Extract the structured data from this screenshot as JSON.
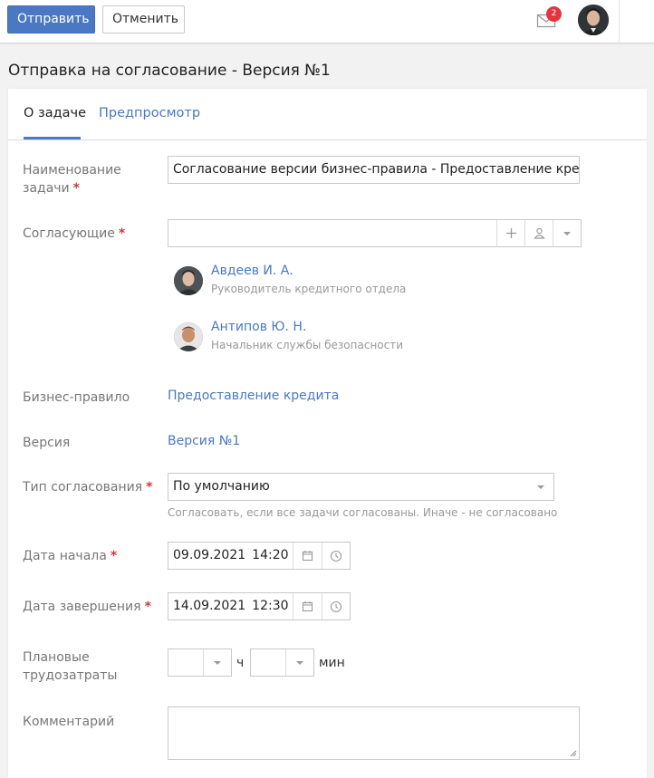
{
  "toolbar": {
    "send_label": "Отправить",
    "cancel_label": "Отменить"
  },
  "header": {
    "notifications_count": "2"
  },
  "page": {
    "title": "Отправка на согласование - Версия №1"
  },
  "tabs": [
    {
      "label": "О задаче",
      "active": true
    },
    {
      "label": "Предпросмотр",
      "active": false
    }
  ],
  "form": {
    "task_name": {
      "label_line1": "Наименование",
      "label_line2": "задачи",
      "value": "Согласование версии бизнес-правила - Предоставление кре"
    },
    "approvers": {
      "label": "Согласующие",
      "value": "",
      "people": [
        {
          "name": "Авдеев И. А.",
          "role": "Руководитель кредитного отдела"
        },
        {
          "name": "Антипов Ю. Н.",
          "role": "Начальник службы безопасности"
        }
      ]
    },
    "business_rule": {
      "label": "Бизнес-правило",
      "value": "Предоставление кредита"
    },
    "version": {
      "label": "Версия",
      "value": "Версия №1"
    },
    "approval_type": {
      "label": "Тип согласования",
      "value": "По умолчанию",
      "hint": "Согласовать, если все задачи согласованы. Иначе - не согласовано"
    },
    "start_date": {
      "label": "Дата начала",
      "date": "09.09.2021",
      "time": "14:20"
    },
    "end_date": {
      "label": "Дата завершения",
      "date": "14.09.2021",
      "time": "12:30"
    },
    "effort": {
      "label_line1": "Плановые",
      "label_line2": "трудозатраты",
      "hours_value": "",
      "hours_unit": "ч",
      "minutes_value": "",
      "minutes_unit": "мин"
    },
    "comment": {
      "label": "Комментарий",
      "value": ""
    }
  },
  "colors": {
    "accent": "#4a78c2",
    "required": "#d0383f",
    "badge": "#e4343e"
  }
}
